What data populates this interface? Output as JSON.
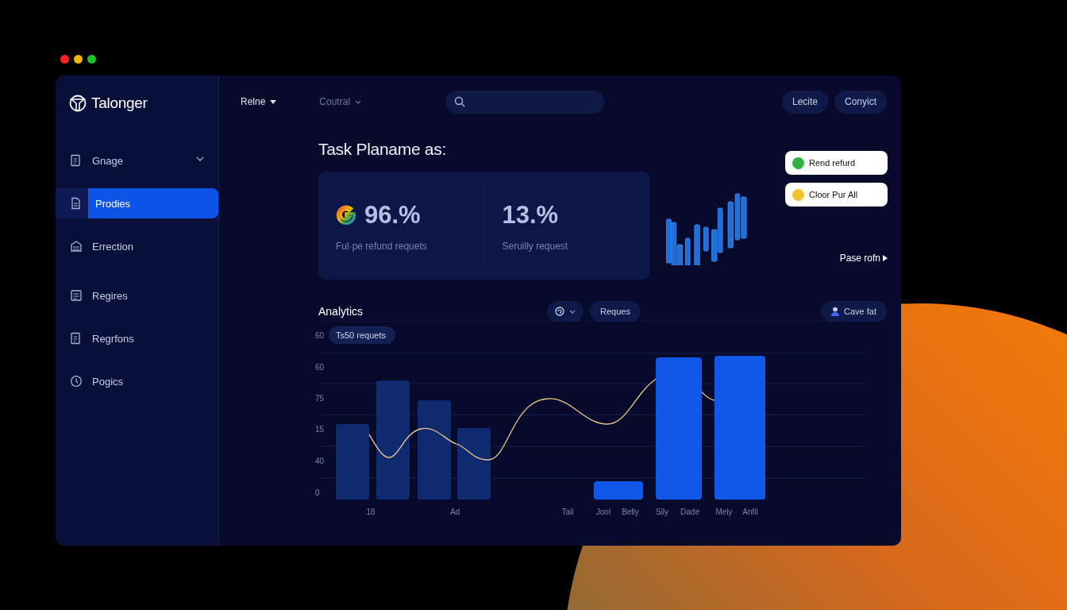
{
  "brand": {
    "name": "Talonger"
  },
  "sidebar": {
    "items": [
      {
        "label": "Gnage",
        "selected": false,
        "expandable": true
      },
      {
        "label": "Prodies",
        "selected": true,
        "expandable": false
      },
      {
        "label": "Errection",
        "selected": false,
        "expandable": false
      },
      {
        "label": "Regires",
        "selected": false,
        "expandable": false
      },
      {
        "label": "Regrfons",
        "selected": false,
        "expandable": false
      },
      {
        "label": "Pogics",
        "selected": false,
        "expandable": false
      }
    ]
  },
  "topbar": {
    "menus": [
      {
        "label": "Relne",
        "selected": true
      },
      {
        "label": "Coutral",
        "selected": false
      }
    ],
    "buttons": [
      "Lecite",
      "Conyict"
    ]
  },
  "heading": "Task Planame as:",
  "stats": [
    {
      "value": "96.%",
      "label": "Ful·pe refund requets",
      "logo": true
    },
    {
      "value": "13.%",
      "label": "Seruilly request",
      "logo": false
    }
  ],
  "actions": [
    {
      "label": "Rend refurd",
      "color": "#2fb344"
    },
    {
      "label": "Cloor Pur All",
      "color": "#f4c430"
    }
  ],
  "more_link": "Pase rofn",
  "analytics": {
    "title": "Analytics",
    "filter_button": "Reques",
    "save_button": "Cave fat",
    "badge": "Ts50 requets",
    "y_labels": [
      "60",
      "60",
      "75",
      "15",
      "40",
      "0"
    ],
    "x_labels": [
      "18",
      "Ad",
      "Tail",
      "Jool",
      "Belly",
      "Sily",
      "Dade",
      "Mely",
      "Anfil"
    ]
  }
}
